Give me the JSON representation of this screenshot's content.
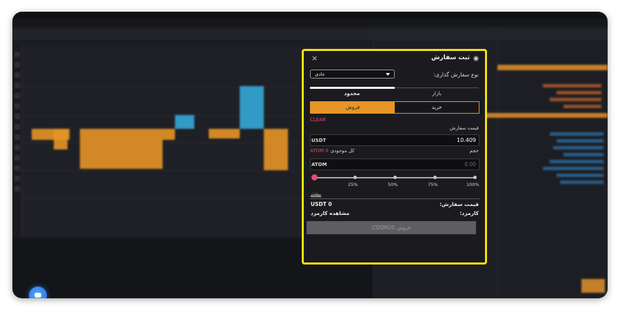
{
  "order_dialog": {
    "title": "ثبت سفارش",
    "close_icon": "×",
    "order_type_label": "نوع سفارش گذاری:",
    "order_type_value": "عادی",
    "tabs": {
      "limit": "محدود",
      "market": "بازار"
    },
    "sides": {
      "sell": "فروش",
      "buy": "خرید"
    },
    "clear": "CLEAR",
    "price_label": "قیمت سفارش",
    "price_unit": "USDT",
    "price_value": "10.409",
    "volume_label": "حجم",
    "balance_label": "کل موجودی",
    "balance_value": "ATOM 0",
    "amount_unit": "ATOM",
    "amount_value": "0.00",
    "slider_percent": 0,
    "slider_ticks": [
      "25%",
      "50%",
      "75%",
      "100%"
    ],
    "more_link": "بیشتر",
    "summary_price_label": "قیمت سفارش:",
    "summary_price_value": "USDT 0",
    "fee_label": "کارمزد:",
    "fee_link": "مشاهده کارمزد",
    "submit_label": "فروش COSMOS"
  },
  "colors": {
    "accent": "#e69526",
    "pink": "#e8487a",
    "highlight_border": "#f1e30f",
    "chart_blue": "#33a8d8"
  }
}
